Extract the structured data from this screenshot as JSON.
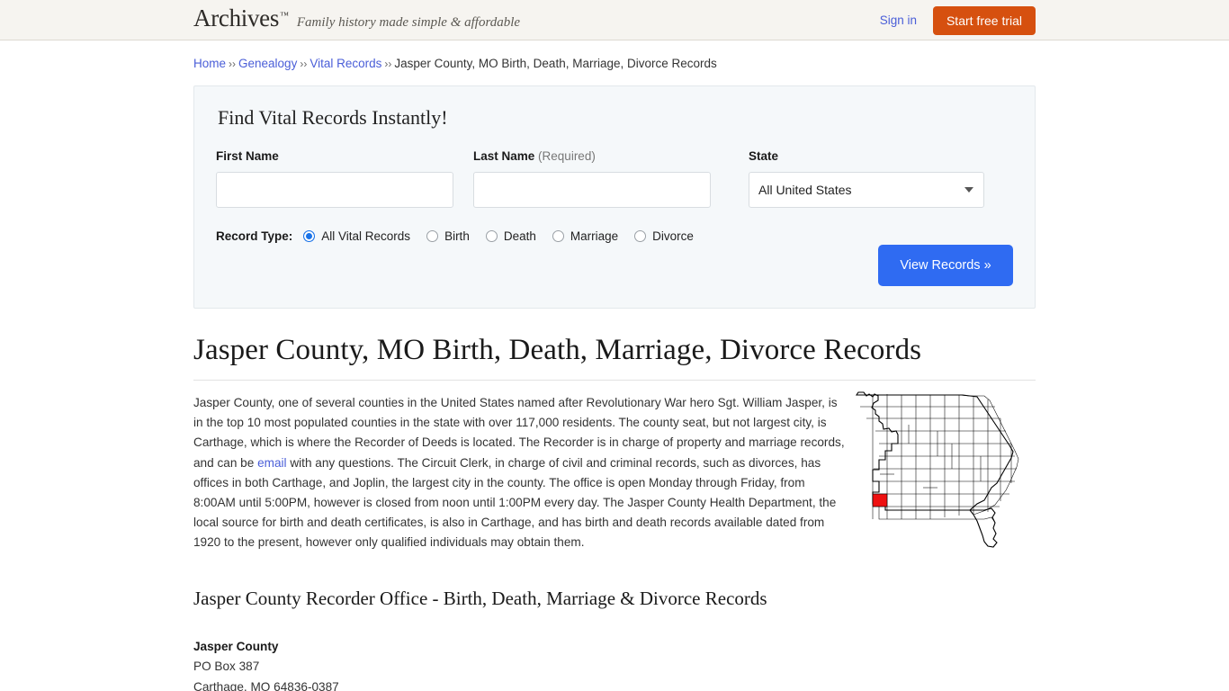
{
  "header": {
    "brand_name": "Archives",
    "brand_tm": "™",
    "tagline": "Family history made simple & affordable",
    "signin_label": "Sign in",
    "trial_label": "Start free trial",
    "accent_orange": "#d6500f",
    "link_blue": "#4a5ed8"
  },
  "breadcrumb": {
    "separator": "››",
    "items": [
      {
        "label": "Home",
        "link": true
      },
      {
        "label": "Genealogy",
        "link": true
      },
      {
        "label": "Vital Records",
        "link": true
      },
      {
        "label": "Jasper County, MO Birth, Death, Marriage, Divorce Records",
        "link": false
      }
    ]
  },
  "search_panel": {
    "title": "Find Vital Records Instantly!",
    "first_name": {
      "label": "First Name",
      "value": "",
      "placeholder": ""
    },
    "last_name": {
      "label": "Last Name",
      "required_note": "(Required)",
      "value": "",
      "placeholder": ""
    },
    "state": {
      "label": "State",
      "selected": "All United States"
    },
    "record_type": {
      "label": "Record Type:",
      "options": [
        {
          "label": "All Vital Records",
          "checked": true
        },
        {
          "label": "Birth",
          "checked": false
        },
        {
          "label": "Death",
          "checked": false
        },
        {
          "label": "Marriage",
          "checked": false
        },
        {
          "label": "Divorce",
          "checked": false
        }
      ]
    },
    "submit_label": "View Records »",
    "submit_color": "#2f6bf2"
  },
  "main": {
    "page_title": "Jasper County, MO Birth, Death, Marriage, Divorce Records",
    "paragraph_part1": "Jasper County, one of several counties in the United States named after Revolutionary War hero Sgt. William Jasper, is in the top 10 most populated counties in the state with over 117,000 residents. The county seat, but not largest city, is Carthage, which is where the Recorder of Deeds is located. The Recorder is in charge of property and marriage records, and can be ",
    "paragraph_link": "email",
    "paragraph_part2": " with any questions. The Circuit Clerk, in charge of civil and criminal records, such as divorces, has offices in both Carthage, and Joplin, the largest city in the county. The office is open Monday through Friday, from 8:00AM until 5:00PM, however is closed from noon until 1:00PM every day. The Jasper County Health Department, the local source for birth and death certificates, is also in Carthage, and has birth and death records available dated from 1920 to the present, however only qualified individuals may obtain them.",
    "map": {
      "name": "missouri-county-map",
      "highlight_color": "#ee1111",
      "highlighted_county": "Jasper"
    },
    "section_heading": "Jasper County Recorder Office - Birth, Death, Marriage & Divorce Records",
    "address": {
      "name": "Jasper County",
      "line1": "PO Box 387",
      "line2": "Carthage, MO 64836-0387"
    }
  }
}
